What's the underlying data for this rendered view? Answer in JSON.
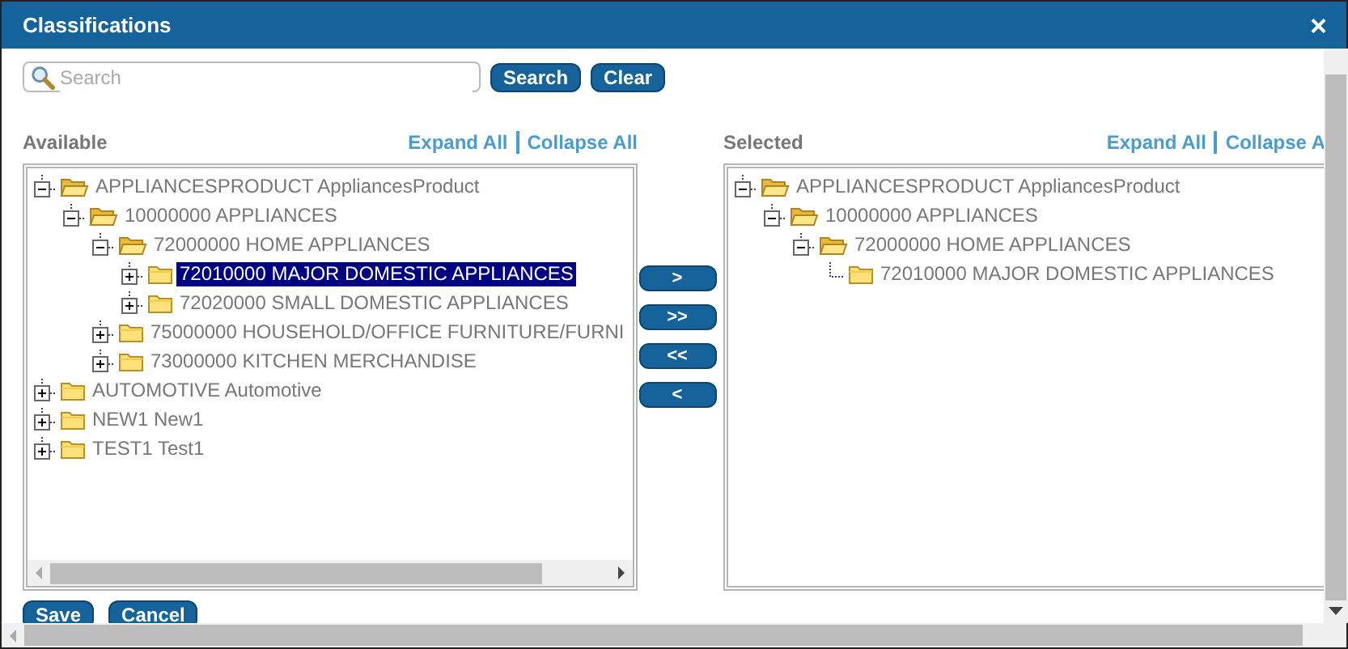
{
  "window": {
    "title": "Classifications",
    "close": "×"
  },
  "search": {
    "placeholder": "Search",
    "buttons": [
      "Search",
      "Clear"
    ]
  },
  "available": {
    "label": "Available",
    "links": [
      "Expand All",
      "Collapse All"
    ],
    "tree": [
      {
        "label": "APPLIANCESPRODUCT AppliancesProduct",
        "kind": "branch",
        "expanded": true,
        "selected": false,
        "children": [
          {
            "label": "10000000 APPLIANCES",
            "kind": "branch",
            "expanded": true,
            "selected": false,
            "children": [
              {
                "label": "72000000 HOME APPLIANCES",
                "kind": "branch",
                "expanded": true,
                "selected": false,
                "children": [
                  {
                    "label": "72010000 MAJOR DOMESTIC APPLIANCES",
                    "kind": "branch",
                    "expanded": false,
                    "selected": true
                  },
                  {
                    "label": "72020000 SMALL DOMESTIC APPLIANCES",
                    "kind": "branch",
                    "expanded": false,
                    "selected": false
                  }
                ]
              },
              {
                "label": "75000000 HOUSEHOLD/OFFICE FURNITURE/FURNI",
                "kind": "branch",
                "expanded": false,
                "selected": false
              },
              {
                "label": "73000000 KITCHEN MERCHANDISE",
                "kind": "branch",
                "expanded": false,
                "selected": false
              }
            ]
          }
        ]
      },
      {
        "label": "AUTOMOTIVE Automotive",
        "kind": "branch",
        "expanded": false,
        "selected": false
      },
      {
        "label": "NEW1 New1",
        "kind": "branch",
        "expanded": false,
        "selected": false
      },
      {
        "label": "TEST1 Test1",
        "kind": "branch",
        "expanded": false,
        "selected": false
      }
    ]
  },
  "move_buttons": [
    ">",
    ">>",
    "<<",
    "<"
  ],
  "selected": {
    "label": "Selected",
    "links": [
      "Expand All",
      "Collapse A"
    ],
    "tree": [
      {
        "label": "APPLIANCESPRODUCT AppliancesProduct",
        "kind": "branch",
        "expanded": true,
        "selected": false,
        "children": [
          {
            "label": "10000000 APPLIANCES",
            "kind": "branch",
            "expanded": true,
            "selected": false,
            "children": [
              {
                "label": "72000000 HOME APPLIANCES",
                "kind": "branch",
                "expanded": true,
                "selected": false,
                "children": [
                  {
                    "label": "72010000 MAJOR DOMESTIC APPLIANCES",
                    "kind": "leaf",
                    "selected": false
                  }
                ]
              }
            ]
          }
        ]
      }
    ]
  },
  "footer_buttons": [
    "Save",
    "Cancel"
  ]
}
